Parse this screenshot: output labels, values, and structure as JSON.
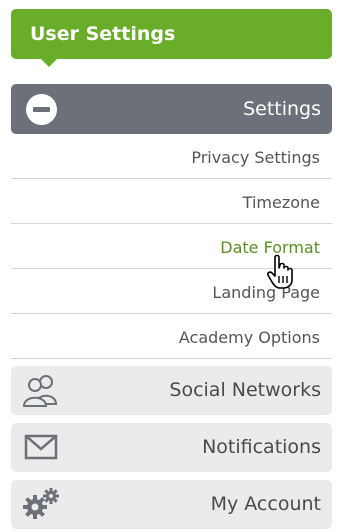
{
  "header": {
    "title": "User Settings"
  },
  "settings": {
    "label": "Settings",
    "items": [
      {
        "label": "Privacy Settings",
        "active": false
      },
      {
        "label": "Timezone",
        "active": false
      },
      {
        "label": "Date Format",
        "active": true
      },
      {
        "label": "Landing Page",
        "active": false
      },
      {
        "label": "Academy Options",
        "active": false
      }
    ]
  },
  "sections": [
    {
      "label": "Social Networks",
      "icon": "users-icon"
    },
    {
      "label": "Notifications",
      "icon": "envelope-icon"
    },
    {
      "label": "My Account",
      "icon": "gears-icon"
    }
  ],
  "colors": {
    "accent": "#6aad2a",
    "active_text": "#5a8f24",
    "settings_bar": "#6b7079",
    "section_bg": "#ebebeb"
  }
}
